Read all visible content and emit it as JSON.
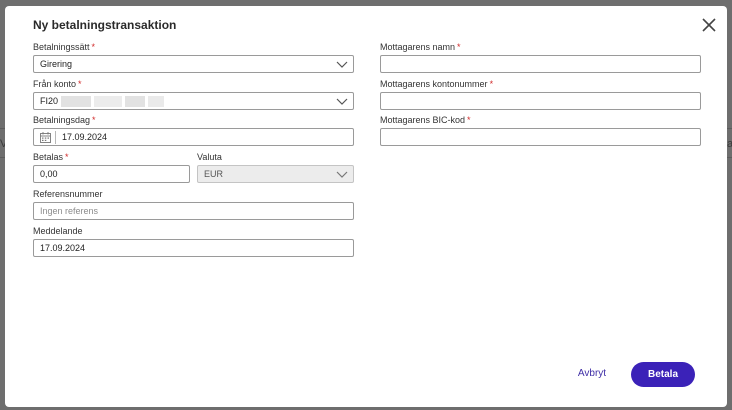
{
  "backdrop": {
    "left_edge_text": "V",
    "right_edge_text": "a"
  },
  "dialog": {
    "title": "Ny betalningstransaktion",
    "close_icon": "close-icon"
  },
  "form": {
    "payment_method": {
      "label": "Betalningssätt",
      "value": "Girering",
      "required": true
    },
    "from_account": {
      "label": "Från konto",
      "value": "FI20",
      "required": true,
      "value_masked": true
    },
    "payment_date": {
      "label": "Betalningsdag",
      "value": "17.09.2024",
      "required": true,
      "icon": "calendar-icon"
    },
    "amount": {
      "label": "Betalas",
      "value": "0,00",
      "required": true
    },
    "currency": {
      "label": "Valuta",
      "value": "EUR",
      "disabled": true
    },
    "reference": {
      "label": "Referensnummer",
      "value": "",
      "placeholder": "Ingen referens"
    },
    "message": {
      "label": "Meddelande",
      "value": "17.09.2024"
    },
    "recipient_name": {
      "label": "Mottagarens namn",
      "value": "",
      "required": true
    },
    "recipient_account": {
      "label": "Mottagarens kontonummer",
      "value": "",
      "required": true
    },
    "recipient_bic": {
      "label": "Mottagarens BIC-kod",
      "value": "",
      "required": true
    }
  },
  "actions": {
    "cancel_label": "Avbryt",
    "submit_label": "Betala"
  },
  "colors": {
    "accent": "#3b22b8",
    "required": "#d12a2a",
    "backdrop": "#6e6e6e"
  }
}
